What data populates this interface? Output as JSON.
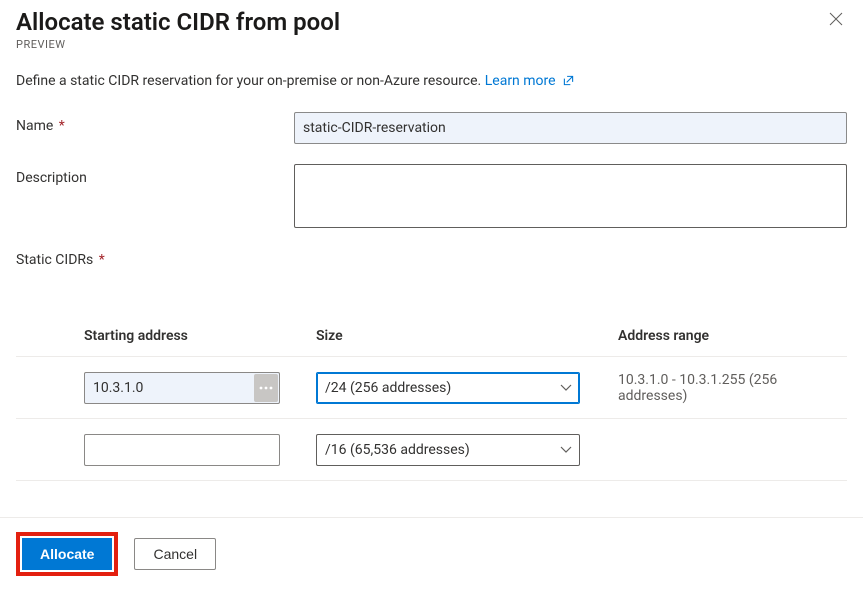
{
  "header": {
    "title": "Allocate static CIDR from pool",
    "badge": "PREVIEW"
  },
  "intro": {
    "text": "Define a static CIDR reservation for your on-premise or non-Azure resource. ",
    "learn_more": "Learn more"
  },
  "fields": {
    "name": {
      "label": "Name",
      "value": "static-CIDR-reservation"
    },
    "description": {
      "label": "Description",
      "value": ""
    },
    "section_label": "Static CIDRs"
  },
  "table": {
    "columns": {
      "start": "Starting address",
      "size": "Size",
      "range": "Address range"
    },
    "rows": [
      {
        "start": "10.3.1.0",
        "size": "/24 (256 addresses)",
        "range": "10.3.1.0 - 10.3.1.255 (256 addresses)"
      },
      {
        "start": "",
        "size": "/16 (65,536 addresses)",
        "range": ""
      }
    ]
  },
  "footer": {
    "primary": "Allocate",
    "secondary": "Cancel"
  }
}
